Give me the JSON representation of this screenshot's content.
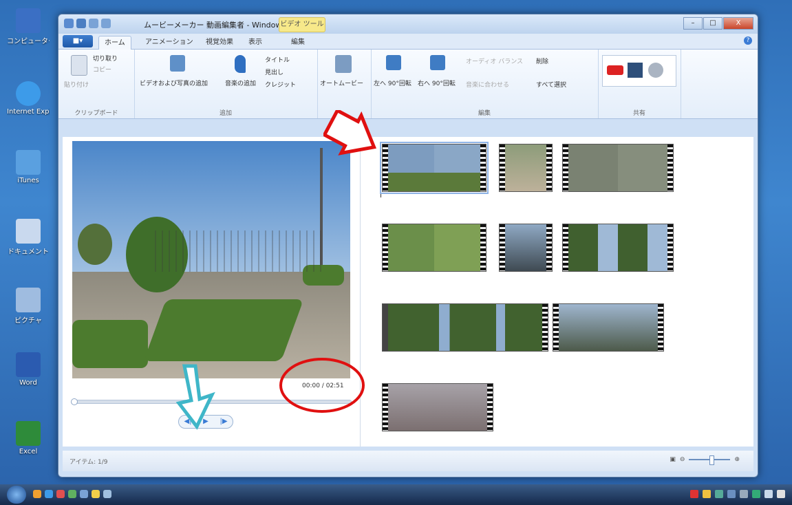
{
  "desktop": {
    "icons": [
      {
        "label": "コンピューター",
        "color": "#3b6fc4"
      },
      {
        "label": "Internet Explorer",
        "color": "#3d9be9"
      },
      {
        "label": "iTunes",
        "color": "#5aa0e0"
      },
      {
        "label": "ドキュメント",
        "color": "#c9d9ee"
      },
      {
        "label": "ピクチャ",
        "color": "#9fbce0"
      },
      {
        "label": "Word",
        "color": "#2b5bb0"
      },
      {
        "label": "Excel",
        "color": "#2e8b3a"
      }
    ]
  },
  "window": {
    "title": "ムービーメーカー 動画編集者 - Windows Li...",
    "context_tab": "ビデオ ツール",
    "controls": {
      "minimize": "–",
      "maximize": "□",
      "close": "X"
    }
  },
  "ribbon_tabs": {
    "file": "■▾",
    "home": "ホーム",
    "animation": "アニメーション",
    "visual_effects": "視覚効果",
    "view": "表示",
    "edit": "編集"
  },
  "ribbon": {
    "clipboard": {
      "paste": "貼り付け",
      "cut": "切り取り",
      "copy": "コピー",
      "label": "クリップボード"
    },
    "add": {
      "add_video": "ビデオおよび写真の追加",
      "add_music": "音楽の追加",
      "title": "タイトル",
      "caption": "見出し",
      "credit": "クレジット",
      "label": "追加"
    },
    "automovie": "オートムービー",
    "editing": {
      "rotate_left": "左へ 90°回転",
      "rotate_right": "右へ 90°回転",
      "audio_balance": "オーディオ バランス",
      "delete": "削除",
      "fit_to_music": "音楽に合わせる",
      "select_all": "すべて選択",
      "label": "編集"
    },
    "share": {
      "label": "共有"
    }
  },
  "player": {
    "timecode": "00:00 / 02:51",
    "position": 0.0
  },
  "status": {
    "items": "アイテム: 1/9"
  },
  "colors": {
    "annotation_red": "#e01010",
    "annotation_cyan": "#3fb6c8",
    "accent": "#3a7bd5"
  }
}
